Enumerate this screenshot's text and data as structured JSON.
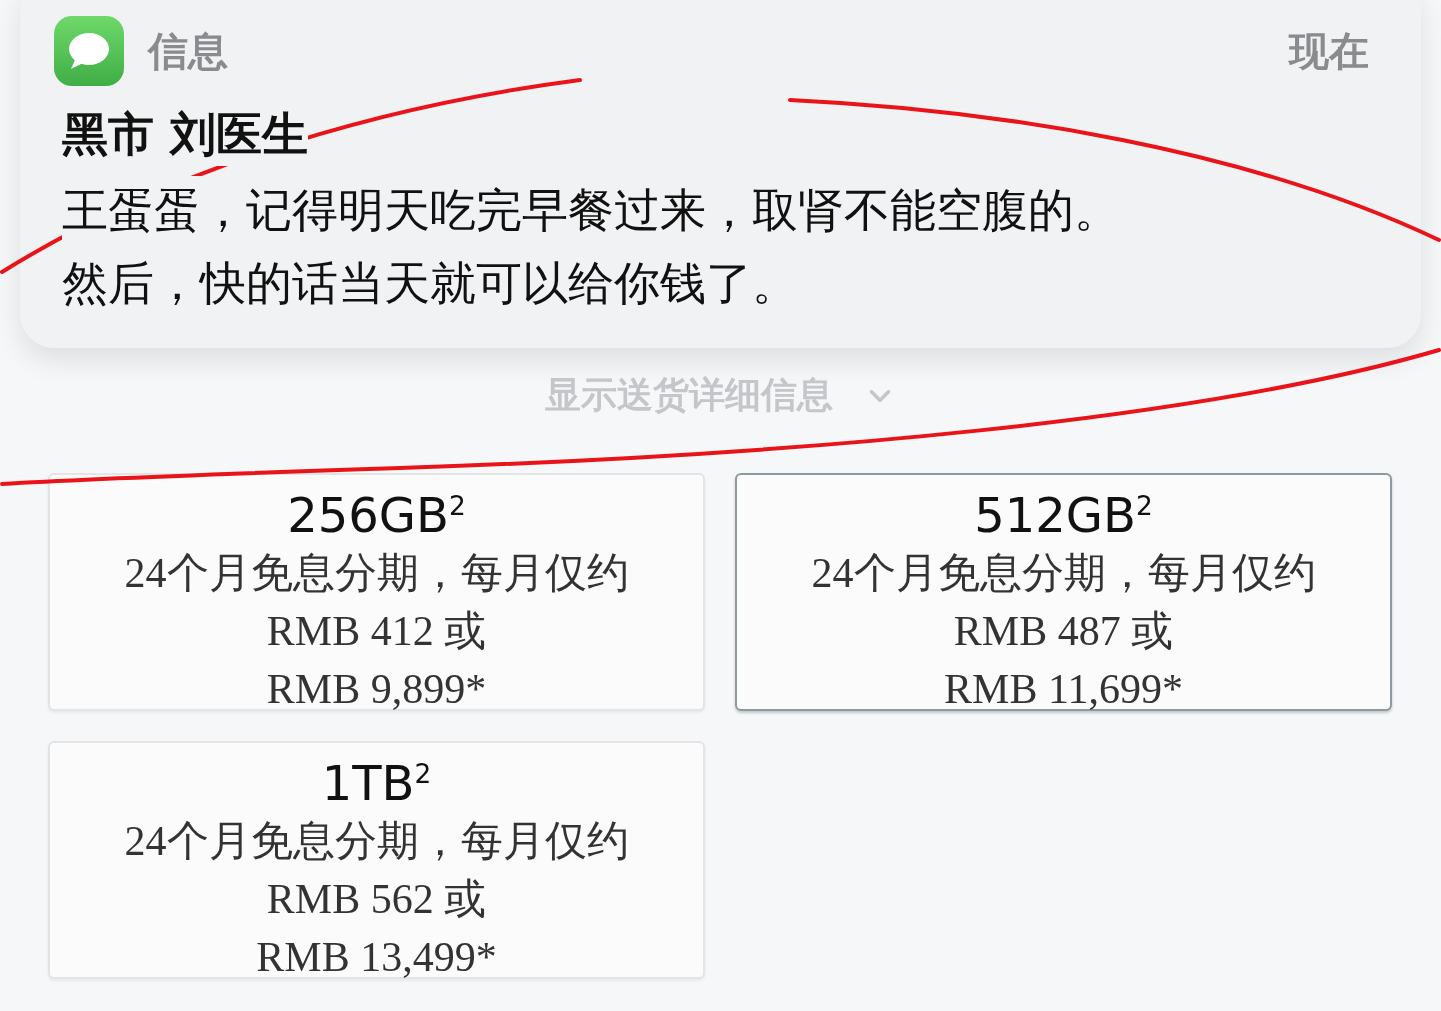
{
  "notification": {
    "app": "信息",
    "time": "现在",
    "sender": "黑市 刘医生",
    "body": [
      "王蛋蛋，记得明天吃完早餐过来，取肾不能空腹的。",
      "然后，快的话当天就可以给你钱了。"
    ]
  },
  "delivery_toggle": {
    "label": "显示送货详细信息",
    "expanded": false
  },
  "options": [
    {
      "capacity": "256GB$^{2}$",
      "plan": "24个月免息分期，每月仅约",
      "monthly": "RMB 412 或",
      "price": "RMB 9,899*",
      "selected": false
    },
    {
      "capacity": "512GB$^{2}$",
      "plan": "24个月免息分期，每月仅约",
      "monthly": "RMB 487 或",
      "price": "RMB 11,699*",
      "selected": true
    },
    {
      "capacity": "1TB$^{2}$",
      "plan": "24个月免息分期，每月仅约",
      "monthly": "RMB 562 或",
      "price": "RMB 13,499*",
      "selected": false
    }
  ]
}
